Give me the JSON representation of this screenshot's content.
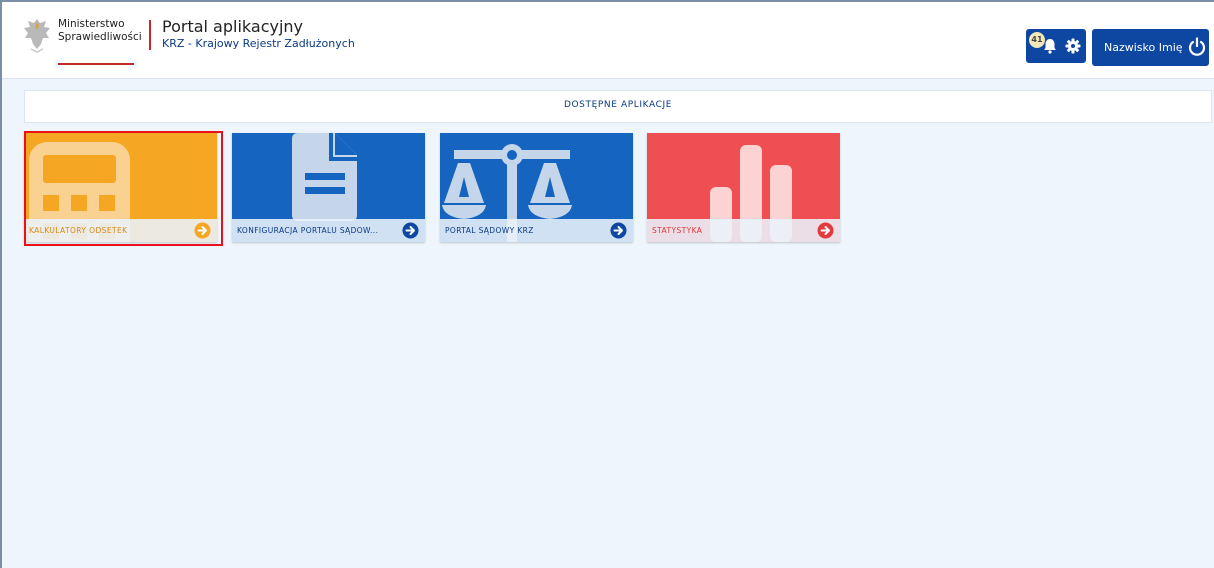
{
  "header": {
    "logo_line1": "Ministerstwo",
    "logo_line2": "Sprawiedliwości",
    "app_title": "Portal aplikacyjny",
    "app_subtitle": "KRZ - Krajowy Rejestr Zadłużonych",
    "notification_count": "41",
    "user_label": "Nazwisko Imię"
  },
  "section": {
    "title": "DOSTĘPNE APLIKACJE"
  },
  "tiles": [
    {
      "label": "KALKULATORY ODSETEK",
      "icon": "calculator-icon",
      "color": "#f5a623",
      "label_color": "#d98a14"
    },
    {
      "label": "KONFIGURACJA PORTALU SĄDOW...",
      "icon": "document-icon",
      "color": "#1565c0",
      "label_color": "#0a3a82"
    },
    {
      "label": "PORTAL SĄDOWY KRZ",
      "icon": "scales-icon",
      "color": "#1565c0",
      "label_color": "#0a3a82"
    },
    {
      "label": "STATYSTYKA",
      "icon": "bar-chart-icon",
      "color": "#ef4f52",
      "label_color": "#e0393c"
    }
  ],
  "colors": {
    "primary": "#0d47a1",
    "accent_red": "#c62828",
    "highlight": "#e8101a"
  }
}
